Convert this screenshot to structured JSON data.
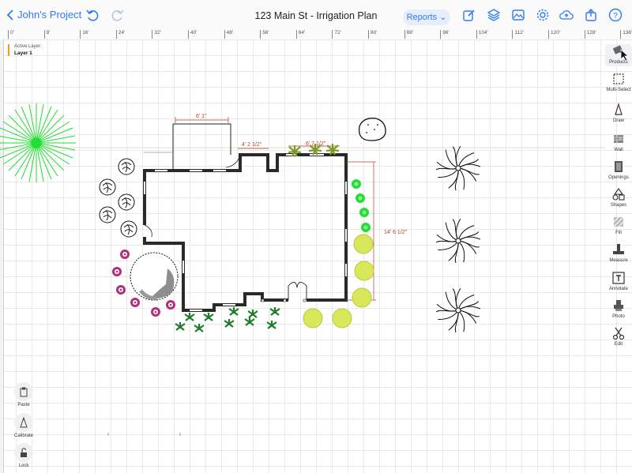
{
  "header": {
    "back_label": "John's Project",
    "title": "123 Main St - Irrigation Plan",
    "reports_label": "Reports"
  },
  "ruler": {
    "ticks": [
      "0'",
      "8'",
      "16'",
      "24'",
      "32'",
      "40'",
      "48'",
      "56'",
      "64'",
      "72'",
      "80'",
      "88'",
      "96'",
      "104'",
      "112'",
      "120'",
      "128'",
      "136'"
    ]
  },
  "layer": {
    "heading": "Active Layer:",
    "name": "Layer 1"
  },
  "tools": [
    {
      "label": "Products",
      "icon": "products-icon"
    },
    {
      "label": "Multi-Select",
      "icon": "multi-select-icon"
    },
    {
      "label": "Draw",
      "icon": "draw-icon"
    },
    {
      "label": "Wall",
      "icon": "wall-icon"
    },
    {
      "label": "Openings",
      "icon": "openings-icon"
    },
    {
      "label": "Shapes",
      "icon": "shapes-icon"
    },
    {
      "label": "Fill",
      "icon": "fill-icon"
    },
    {
      "label": "Measure",
      "icon": "measure-icon"
    },
    {
      "label": "Annotate",
      "icon": "annotate-icon"
    },
    {
      "label": "Photo",
      "icon": "photo-icon"
    },
    {
      "label": "Edit",
      "icon": "edit-icon"
    }
  ],
  "left_tools": [
    {
      "label": "Paste",
      "icon": "paste-icon"
    },
    {
      "label": "Calibrate",
      "icon": "calibrate-icon"
    },
    {
      "label": "Lock",
      "icon": "lock-icon"
    }
  ],
  "dimensions": {
    "top": "6' 1\"",
    "step": "4' 2 1/2\"",
    "ferns": "6' 7 1/2\"",
    "right": "14' 6 1/2\""
  },
  "colors": {
    "accent": "#2f7bf5",
    "dimension": "#c0392b",
    "layer_marker": "#f29a2e",
    "palm_green": "#22dd33",
    "shrub_lime": "#d9e85a",
    "flower_pink": "#b0307a"
  }
}
